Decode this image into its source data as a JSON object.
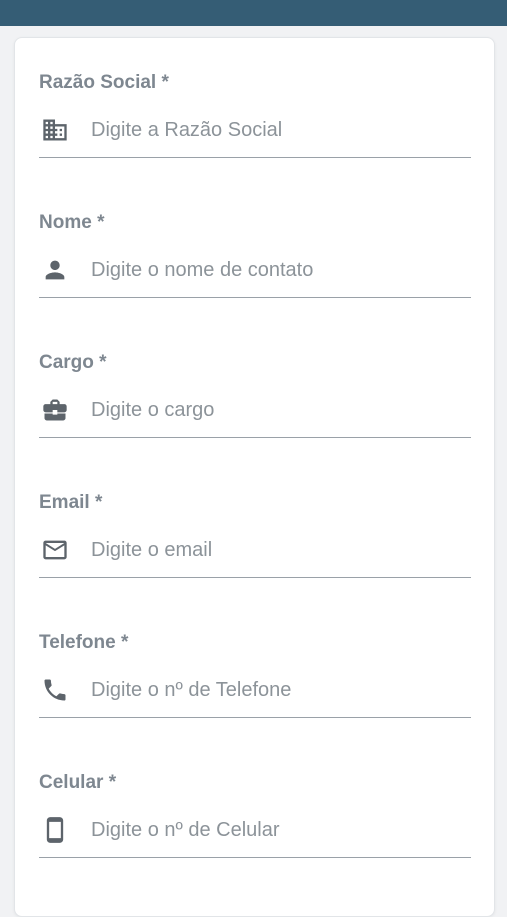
{
  "form": {
    "fields": [
      {
        "label": "Razão Social *",
        "placeholder": "Digite a Razão Social",
        "value": "",
        "icon": "building-icon"
      },
      {
        "label": "Nome *",
        "placeholder": "Digite o nome de contato",
        "value": "",
        "icon": "person-icon"
      },
      {
        "label": "Cargo *",
        "placeholder": "Digite o cargo",
        "value": "",
        "icon": "briefcase-icon"
      },
      {
        "label": "Email *",
        "placeholder": "Digite o email",
        "value": "",
        "icon": "mail-icon"
      },
      {
        "label": "Telefone *",
        "placeholder": "Digite o nº de Telefone",
        "value": "",
        "icon": "phone-icon"
      },
      {
        "label": "Celular *",
        "placeholder": "Digite o nº de Celular",
        "value": "",
        "icon": "mobile-icon"
      }
    ]
  },
  "colors": {
    "header": "#355d75",
    "label": "#7e8790",
    "placeholder": "#8c9399",
    "underline": "#9aa1a8",
    "icon": "#5d646b"
  }
}
